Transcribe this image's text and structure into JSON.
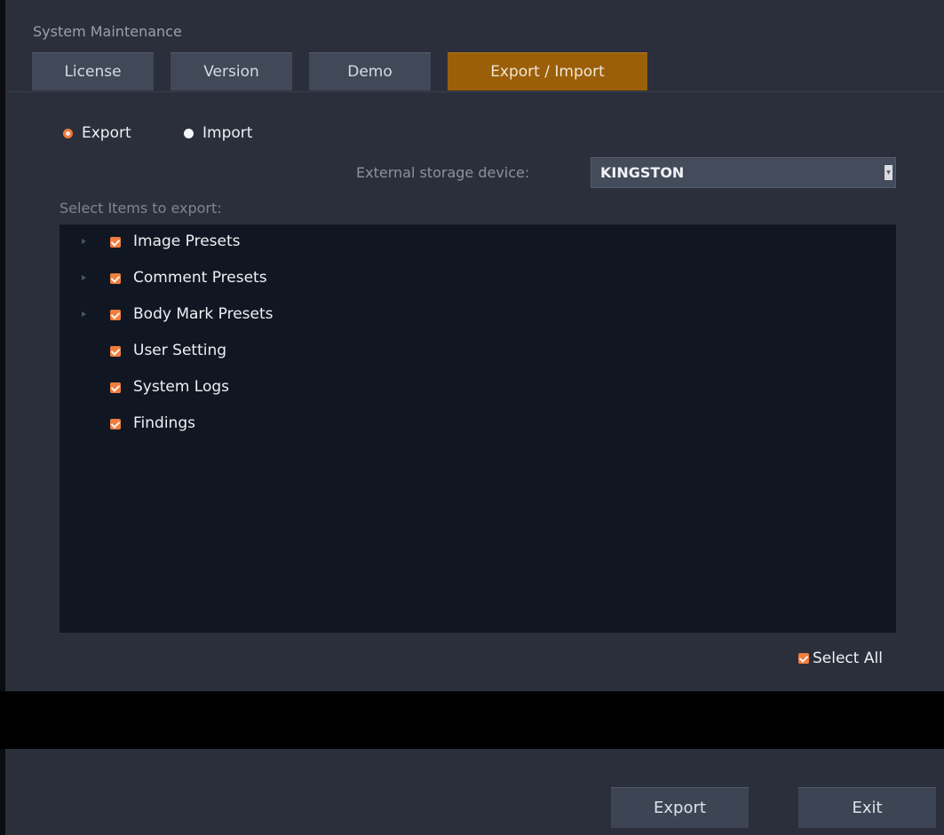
{
  "window": {
    "title": "System Maintenance"
  },
  "tabs": [
    {
      "label": "License",
      "active": false
    },
    {
      "label": "Version",
      "active": false
    },
    {
      "label": "Demo",
      "active": false
    },
    {
      "label": "Export / Import",
      "active": true
    }
  ],
  "mode": {
    "export_label": "Export",
    "import_label": "Import",
    "selected": "Export"
  },
  "storage": {
    "label": "External storage device:",
    "value": "KINGSTON"
  },
  "items": {
    "heading": "Select Items to export:",
    "list": [
      {
        "label": "Image Presets",
        "checked": true,
        "expandable": true
      },
      {
        "label": "Comment Presets",
        "checked": true,
        "expandable": true
      },
      {
        "label": "Body Mark Presets",
        "checked": true,
        "expandable": true
      },
      {
        "label": "User Setting",
        "checked": true,
        "expandable": false
      },
      {
        "label": "System Logs",
        "checked": true,
        "expandable": false
      },
      {
        "label": "Findings",
        "checked": true,
        "expandable": false
      }
    ]
  },
  "select_all": {
    "label": "Select All",
    "checked": true
  },
  "buttons": {
    "export_label": "Export",
    "exit_label": "Exit"
  },
  "colors": {
    "accent_tab": "#9a5f08",
    "checkbox": "#ef7d3e",
    "background": "#2a2f3b",
    "tree_panel": "#111722"
  }
}
